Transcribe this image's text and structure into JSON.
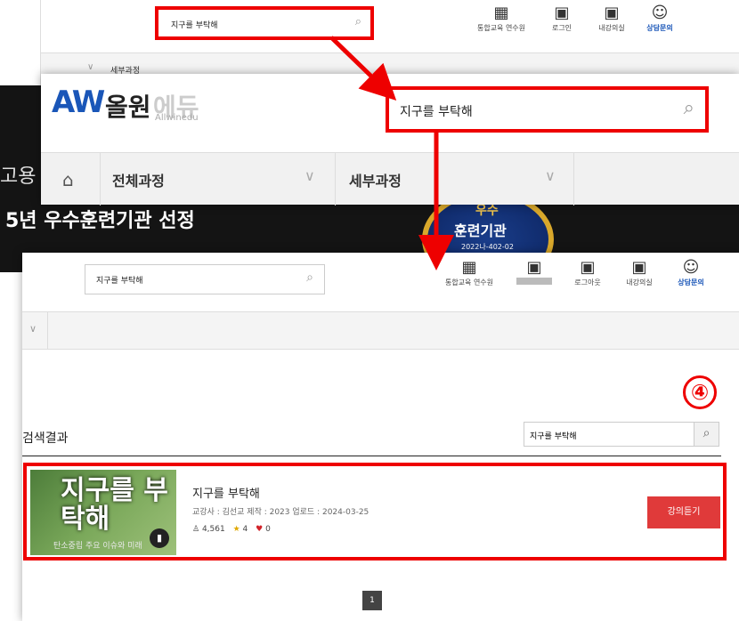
{
  "search_query": "지구를 부탁해",
  "top_menu": [
    {
      "icon": "training-center-icon",
      "label": "통합교육 연수원"
    },
    {
      "icon": "login-icon",
      "label": "로그인"
    },
    {
      "icon": "classroom-icon",
      "label": "내강의실"
    },
    {
      "icon": "consult-icon",
      "label": "상담문의"
    }
  ],
  "top_menu_loggedin": [
    {
      "icon": "training-center-icon",
      "label": "통합교육 연수원"
    },
    {
      "icon": "user-icon",
      "label": ""
    },
    {
      "icon": "logout-icon",
      "label": "로그아웃"
    },
    {
      "icon": "classroom-icon",
      "label": "내강의실"
    },
    {
      "icon": "consult-icon",
      "label": "상담문의"
    }
  ],
  "layer1": {
    "nav_sub": "세부과정",
    "banner_left": "고용",
    "banner_main": "5년 우수훈련기관 선정",
    "badge_top": "우수",
    "badge_main": "훈련기관",
    "badge_code": "2022나-402-02"
  },
  "logo": {
    "mark": "AW",
    "name": "올원",
    "name2": "에듀",
    "sub": "Allwinedu"
  },
  "nav": {
    "all_courses": "전체과정",
    "sub_courses": "세부과정"
  },
  "results": {
    "heading": "검색결과",
    "step_number": "④",
    "items": [
      {
        "title": "지구를 부탁해",
        "thumb_title": "지구를 부탁해",
        "thumb_sub": "탄소중립 주요 이슈와 미래",
        "meta": "교강사 : 김선교   제작 : 2023   업로드 : 2024-03-25",
        "views": "4,561",
        "rating": "4",
        "likes": "0",
        "action": "강의듣기"
      }
    ],
    "page": "1"
  },
  "colors": {
    "highlight": "#e00000",
    "accent": "#e03a3a",
    "brand": "#1a56b8"
  }
}
